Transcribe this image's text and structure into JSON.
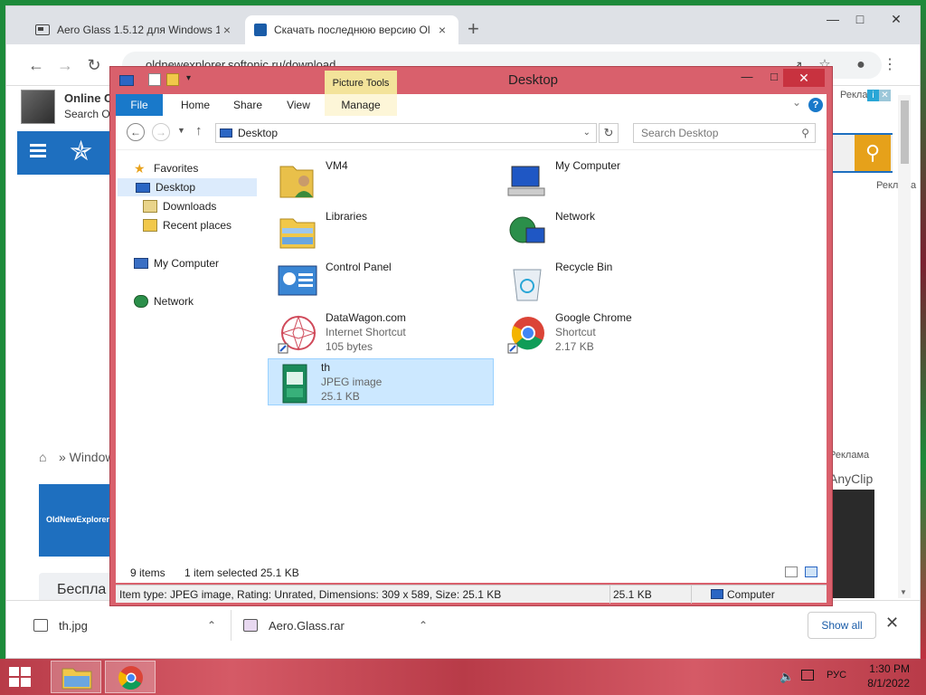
{
  "browser": {
    "tabs": [
      {
        "title": "Aero Glass 1.5.12 для Windows 1"
      },
      {
        "title": "Скачать последнюю версию Ol"
      }
    ],
    "url": "oldnewexplorer.softonic.ru/download",
    "close_symbol": "×",
    "new_tab_symbol": "+"
  },
  "site": {
    "banner_title": "Online C",
    "banner_sub": "Search O",
    "ad_label": "Реклама",
    "breadcrumb": "» Window",
    "anyclip": "AnyClip",
    "oldnew_banner": "OldNewExplorer",
    "free_card": "Беспла"
  },
  "downloads": {
    "items": [
      {
        "name": "th.jpg"
      },
      {
        "name": "Aero.Glass.rar"
      }
    ],
    "show_all": "Show all"
  },
  "explorer": {
    "title": "Desktop",
    "context_tab": "Picture Tools",
    "ribbon_tabs": [
      "File",
      "Home",
      "Share",
      "View",
      "Manage"
    ],
    "address": "Desktop",
    "search_placeholder": "Search Desktop",
    "nav": {
      "favorites": "Favorites",
      "desktop": "Desktop",
      "downloads": "Downloads",
      "recent": "Recent places",
      "my_computer": "My Computer",
      "network": "Network"
    },
    "items": [
      {
        "name": "VM4",
        "sub1": "",
        "sub2": "",
        "icon": "user-folder-icon"
      },
      {
        "name": "My Computer",
        "sub1": "",
        "sub2": "",
        "icon": "computer-icon"
      },
      {
        "name": "Libraries",
        "sub1": "",
        "sub2": "",
        "icon": "libraries-icon"
      },
      {
        "name": "Network",
        "sub1": "",
        "sub2": "",
        "icon": "network-icon"
      },
      {
        "name": "Control Panel",
        "sub1": "",
        "sub2": "",
        "icon": "control-panel-icon"
      },
      {
        "name": "Recycle Bin",
        "sub1": "",
        "sub2": "",
        "icon": "recycle-bin-icon"
      },
      {
        "name": "DataWagon.com",
        "sub1": "Internet Shortcut",
        "sub2": "105 bytes",
        "icon": "internet-shortcut-icon"
      },
      {
        "name": "Google Chrome",
        "sub1": "Shortcut",
        "sub2": "2.17 KB",
        "icon": "chrome-icon"
      },
      {
        "name": "th",
        "sub1": "JPEG image",
        "sub2": "25.1 KB",
        "icon": "jpeg-image-icon"
      }
    ],
    "status": {
      "count": "9 items",
      "selected": "1 item selected",
      "size": "25.1 KB"
    },
    "details": {
      "info": "Item type: JPEG image, Rating: Unrated, Dimensions: 309 x 589, Size: 25.1 KB",
      "size": "25.1 KB",
      "location": "Computer"
    }
  },
  "tray": {
    "lang": "РУС",
    "time": "1:30 PM",
    "date": "8/1/2022"
  }
}
